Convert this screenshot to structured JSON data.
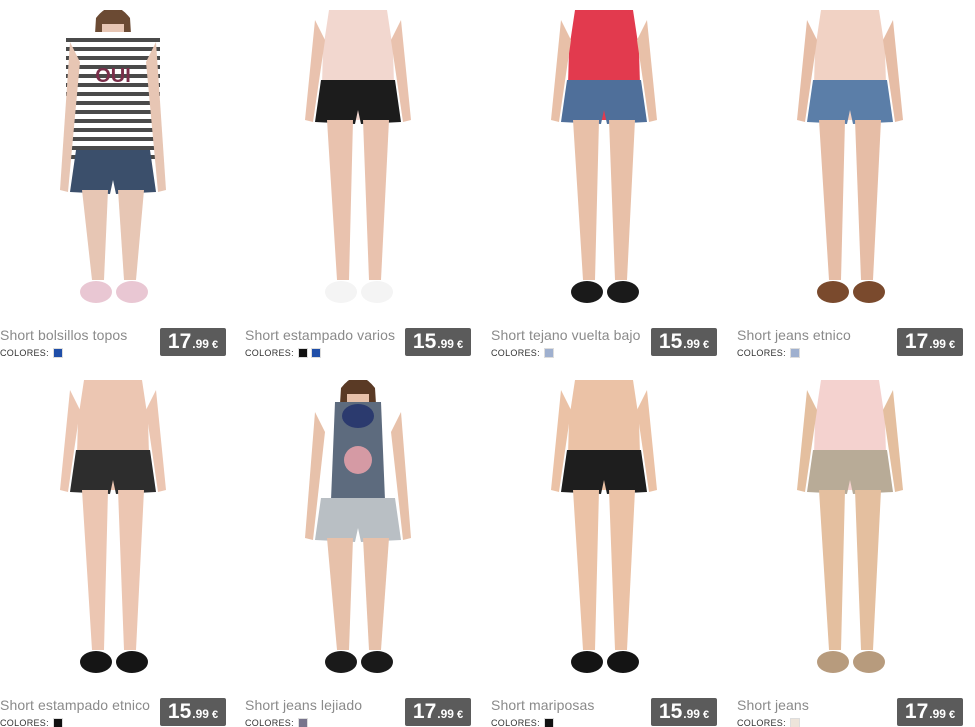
{
  "products": [
    {
      "name": "Short bolsillos topos",
      "colores_label": "COLORES:",
      "price_int": "17",
      "price_dec": ".99",
      "currency": "€",
      "swatches": [
        "#1f4ea8"
      ],
      "skin": "#e7c6b4",
      "top": "#ffffff",
      "top2": "#4a4a4a",
      "bottom": "#3b4f6b",
      "shoe": "#e9c7d3",
      "hair": "#6b4a33"
    },
    {
      "name": "Short estampado varios",
      "colores_label": "COLORES:",
      "price_int": "15",
      "price_dec": ".99",
      "currency": "€",
      "swatches": [
        "#111111",
        "#1f4ea8"
      ],
      "skin": "#e9c2ae",
      "top": "#f2d7cf",
      "top2": "#f2d7cf",
      "bottom": "#1c1c1c",
      "shoe": "#f4f4f4",
      "hair": "#000000"
    },
    {
      "name": "Short tejano vuelta bajo",
      "colores_label": "COLORES:",
      "price_int": "15",
      "price_dec": ".99",
      "currency": "€",
      "swatches": [
        "#9fb0cf"
      ],
      "skin": "#e8c0a8",
      "top": "#e23a4e",
      "top2": "#e23a4e",
      "bottom": "#4f6f9a",
      "shoe": "#1a1a1a",
      "hair": "#000000"
    },
    {
      "name": "Short jeans etnico",
      "colores_label": "COLORES:",
      "price_int": "17",
      "price_dec": ".99",
      "currency": "€",
      "swatches": [
        "#9fb0cf"
      ],
      "skin": "#e6bda6",
      "top": "#f1d2c4",
      "top2": "#f1d2c4",
      "bottom": "#5b7ea8",
      "shoe": "#7a4a2d",
      "hair": "#000000"
    },
    {
      "name": "Short estampado etnico",
      "colores_label": "COLORES:",
      "price_int": "15",
      "price_dec": ".99",
      "currency": "€",
      "swatches": [
        "#111111"
      ],
      "skin": "#ecc6b2",
      "top": "#ecc6b2",
      "top2": "#ecc6b2",
      "bottom": "#2d2d2d",
      "shoe": "#151515",
      "hair": "#000000"
    },
    {
      "name": "Short jeans lejiado",
      "colores_label": "COLORES:",
      "price_int": "17",
      "price_dec": ".99",
      "currency": "€",
      "swatches": [
        "#77748c"
      ],
      "skin": "#e7c1aa",
      "top": "#5d6b7e",
      "top2": "#2b3a6e",
      "bottom": "#b9bfc4",
      "shoe": "#1a1a1a",
      "hair": "#5a3a25"
    },
    {
      "name": "Short mariposas",
      "colores_label": "COLORES:",
      "price_int": "15",
      "price_dec": ".99",
      "currency": "€",
      "swatches": [
        "#111111"
      ],
      "skin": "#ebc2a6",
      "top": "#ebc2a6",
      "top2": "#ebc2a6",
      "bottom": "#1e1e1e",
      "shoe": "#141414",
      "hair": "#000000"
    },
    {
      "name": "Short jeans",
      "colores_label": "COLORES:",
      "price_int": "17",
      "price_dec": ".99",
      "currency": "€",
      "swatches": [
        "#ede4da"
      ],
      "skin": "#e4bf9f",
      "top": "#f4d2cf",
      "top2": "#f4d2cf",
      "bottom": "#b8ab97",
      "shoe": "#b79b7d",
      "hair": "#000000"
    }
  ]
}
